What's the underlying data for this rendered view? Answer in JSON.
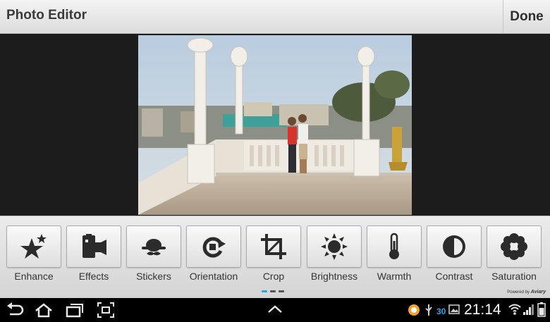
{
  "header": {
    "title": "Photo Editor",
    "done_label": "Done"
  },
  "tools": [
    {
      "label": "Enhance",
      "icon": "star-sparkle-icon"
    },
    {
      "label": "Effects",
      "icon": "film-strip-icon"
    },
    {
      "label": "Stickers",
      "icon": "hat-mustache-icon"
    },
    {
      "label": "Orientation",
      "icon": "rotate-icon"
    },
    {
      "label": "Crop",
      "icon": "crop-icon"
    },
    {
      "label": "Brightness",
      "icon": "sun-icon"
    },
    {
      "label": "Warmth",
      "icon": "thermometer-icon"
    },
    {
      "label": "Contrast",
      "icon": "contrast-icon"
    },
    {
      "label": "Saturation",
      "icon": "flower-icon"
    }
  ],
  "pager": {
    "pages": 3,
    "current": 1
  },
  "powered_by": {
    "prefix": "Powered by",
    "brand": "Aviary"
  },
  "status_bar": {
    "time": "21:14",
    "notification_count": "30",
    "battery_icon": "battery-icon"
  },
  "colors": {
    "accent": "#29a3e2",
    "system_bar": "#000000"
  }
}
